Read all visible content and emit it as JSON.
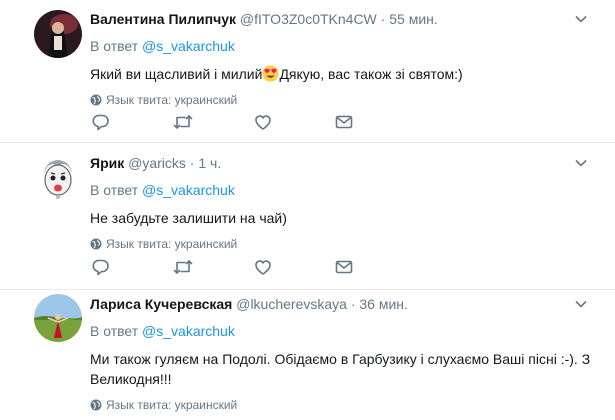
{
  "tweets": [
    {
      "fullname": "Валентина Пилипчук",
      "username": "@fITO3Z0c0TKn4CW",
      "separator": "·",
      "time": "55 мин.",
      "reply_prefix": "В ответ",
      "reply_to": "@s_vakarchuk",
      "text_before": "Який ви щасливий і милий",
      "emoji": "heart-eyes-emoji",
      "text_after": "Дякую, вас також зі святом:)",
      "lang": "Язык твита: украинский"
    },
    {
      "fullname": "Ярик",
      "username": "@yaricks",
      "separator": "·",
      "time": "1 ч.",
      "reply_prefix": "В ответ",
      "reply_to": "@s_vakarchuk",
      "text": "Не забудьте залишити на чай)",
      "lang": "Язык твита: украинский"
    },
    {
      "fullname": "Лариса Кучеревская",
      "username": "@lkucherevskaya",
      "separator": "·",
      "time": "36 мин.",
      "reply_prefix": "В ответ",
      "reply_to": "@s_vakarchuk",
      "text": "Ми також гуляєм на Подолі. Обідаємо в Гарбузику і слухаємо Ваші пісні :-). З Великодня!!!",
      "lang": "Язык твита: украинский"
    }
  ],
  "colors": {
    "text": "#14171a",
    "secondary": "#657786",
    "link": "#1b95e0",
    "divider": "#e6ecf0"
  }
}
